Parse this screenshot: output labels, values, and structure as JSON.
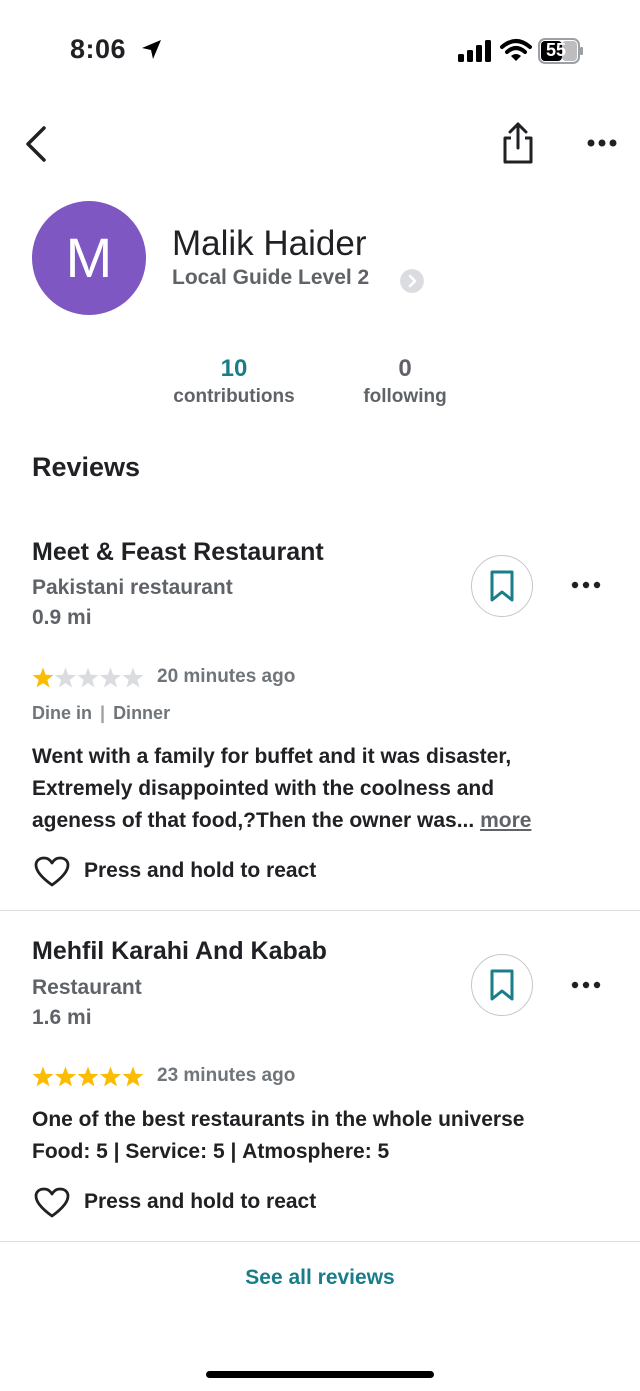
{
  "status_bar": {
    "time": "8:06",
    "battery": "55"
  },
  "profile": {
    "initial": "M",
    "name": "Malik Haider",
    "level": "Local Guide Level 2",
    "contributions_count": "10",
    "contributions_label": "contributions",
    "following_count": "0",
    "following_label": "following"
  },
  "reviews_title": "Reviews",
  "reviews": [
    {
      "place": "Meet & Feast Restaurant",
      "type": "Pakistani restaurant",
      "distance": "0.9 mi",
      "rating": 1,
      "max_rating": 5,
      "time_ago": "20 minutes ago",
      "meta_1": "Dine in",
      "meta_2": "Dinner",
      "text_lines": [
        "Went with a family for buffet and it was disaster,",
        "Extremely disappointed with the coolness and",
        "ageness of that food,?Then the  owner was..."
      ],
      "more_label": "more",
      "react_label": "Press and hold to react"
    },
    {
      "place": "Mehfil Karahi And Kabab",
      "type": "Restaurant",
      "distance": "1.6 mi",
      "rating": 5,
      "max_rating": 5,
      "time_ago": "23 minutes ago",
      "text_line": "One of the best restaurants in the whole universe",
      "ratings_breakdown": [
        {
          "label": "Food",
          "value": "5"
        },
        {
          "label": "Service",
          "value": "5"
        },
        {
          "label": "Atmosphere",
          "value": "5"
        }
      ],
      "react_label": "Press and hold to react"
    }
  ],
  "see_all_label": "See all reviews",
  "colors": {
    "accent": "#1a7d8a",
    "avatar": "#7e57c2",
    "star_filled": "#fbbc04",
    "star_empty": "#dadce0"
  }
}
